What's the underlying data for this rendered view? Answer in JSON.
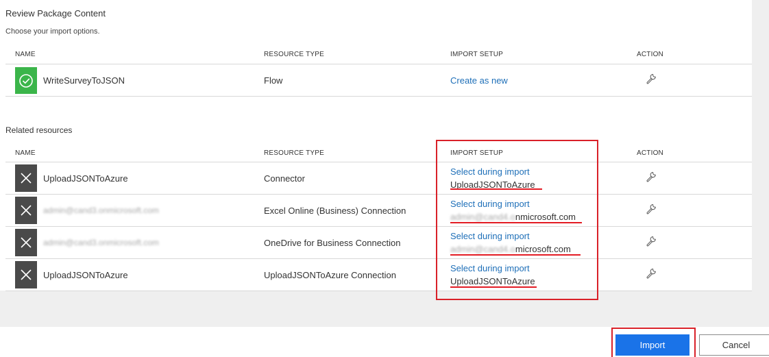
{
  "header": {
    "title": "Review Package Content",
    "subtitle": "Choose your import options."
  },
  "columns": {
    "name": "NAME",
    "resource_type": "RESOURCE TYPE",
    "import_setup": "IMPORT SETUP",
    "action": "ACTION"
  },
  "main_resource": {
    "name": "WriteSurveyToJSON",
    "type": "Flow",
    "import_setup": "Create as new",
    "status_icon": "check-circle-icon",
    "action_icon": "wrench-icon"
  },
  "related": {
    "label": "Related resources",
    "rows": [
      {
        "name": "UploadJSONToAzure",
        "type": "Connector",
        "import_setup": "Select during import",
        "selected": "UploadJSONToAzure"
      },
      {
        "name": "admin@cand3.onmicrosoft.com",
        "type": "Excel Online (Business) Connection",
        "import_setup": "Select during import",
        "selected_blurred": "admin@cand4.o",
        "selected_visible": "nmicrosoft.com"
      },
      {
        "name": "admin@cand3.onmicrosoft.com",
        "type": "OneDrive for Business Connection",
        "import_setup": "Select during import",
        "selected_blurred": "admin@cand4.o",
        "selected_visible": "microsoft.com"
      },
      {
        "name": "UploadJSONToAzure",
        "type": "UploadJSONToAzure Connection",
        "import_setup": "Select during import",
        "selected": "UploadJSONToAzure"
      }
    ]
  },
  "footer": {
    "import_label": "Import",
    "cancel_label": "Cancel"
  },
  "colors": {
    "accent": "#1a73e8",
    "link": "#1e6fb8",
    "success": "#3bb54a",
    "highlight": "#e31b23"
  }
}
